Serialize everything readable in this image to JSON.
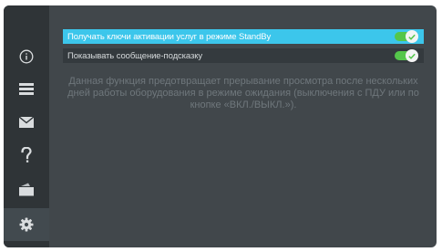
{
  "sidebar": {
    "items": [
      {
        "name": "info",
        "icon": "info-icon"
      },
      {
        "name": "list",
        "icon": "list-icon"
      },
      {
        "name": "messages",
        "icon": "envelope-icon"
      },
      {
        "name": "help",
        "icon": "question-icon"
      },
      {
        "name": "cards",
        "icon": "cards-icon"
      },
      {
        "name": "settings",
        "icon": "gear-icon",
        "active": true
      }
    ]
  },
  "settings": {
    "options": [
      {
        "label": "Получать ключи активации услуг в режиме StandBy",
        "enabled": true,
        "selected": true
      },
      {
        "label": "Показывать сообщение-подсказку",
        "enabled": true,
        "selected": false
      }
    ],
    "description": "Данная функция предотвращает прерывание просмотра после нескольких дней работы оборудования в режиме ожидания (выключения с ПДУ или по кнопке «ВКЛ./ВЫКЛ.»)."
  },
  "colors": {
    "accent": "#3cc6eb",
    "toggle_on": "#55c64b",
    "background": "#41474b",
    "sidebar": "#2f3437"
  }
}
